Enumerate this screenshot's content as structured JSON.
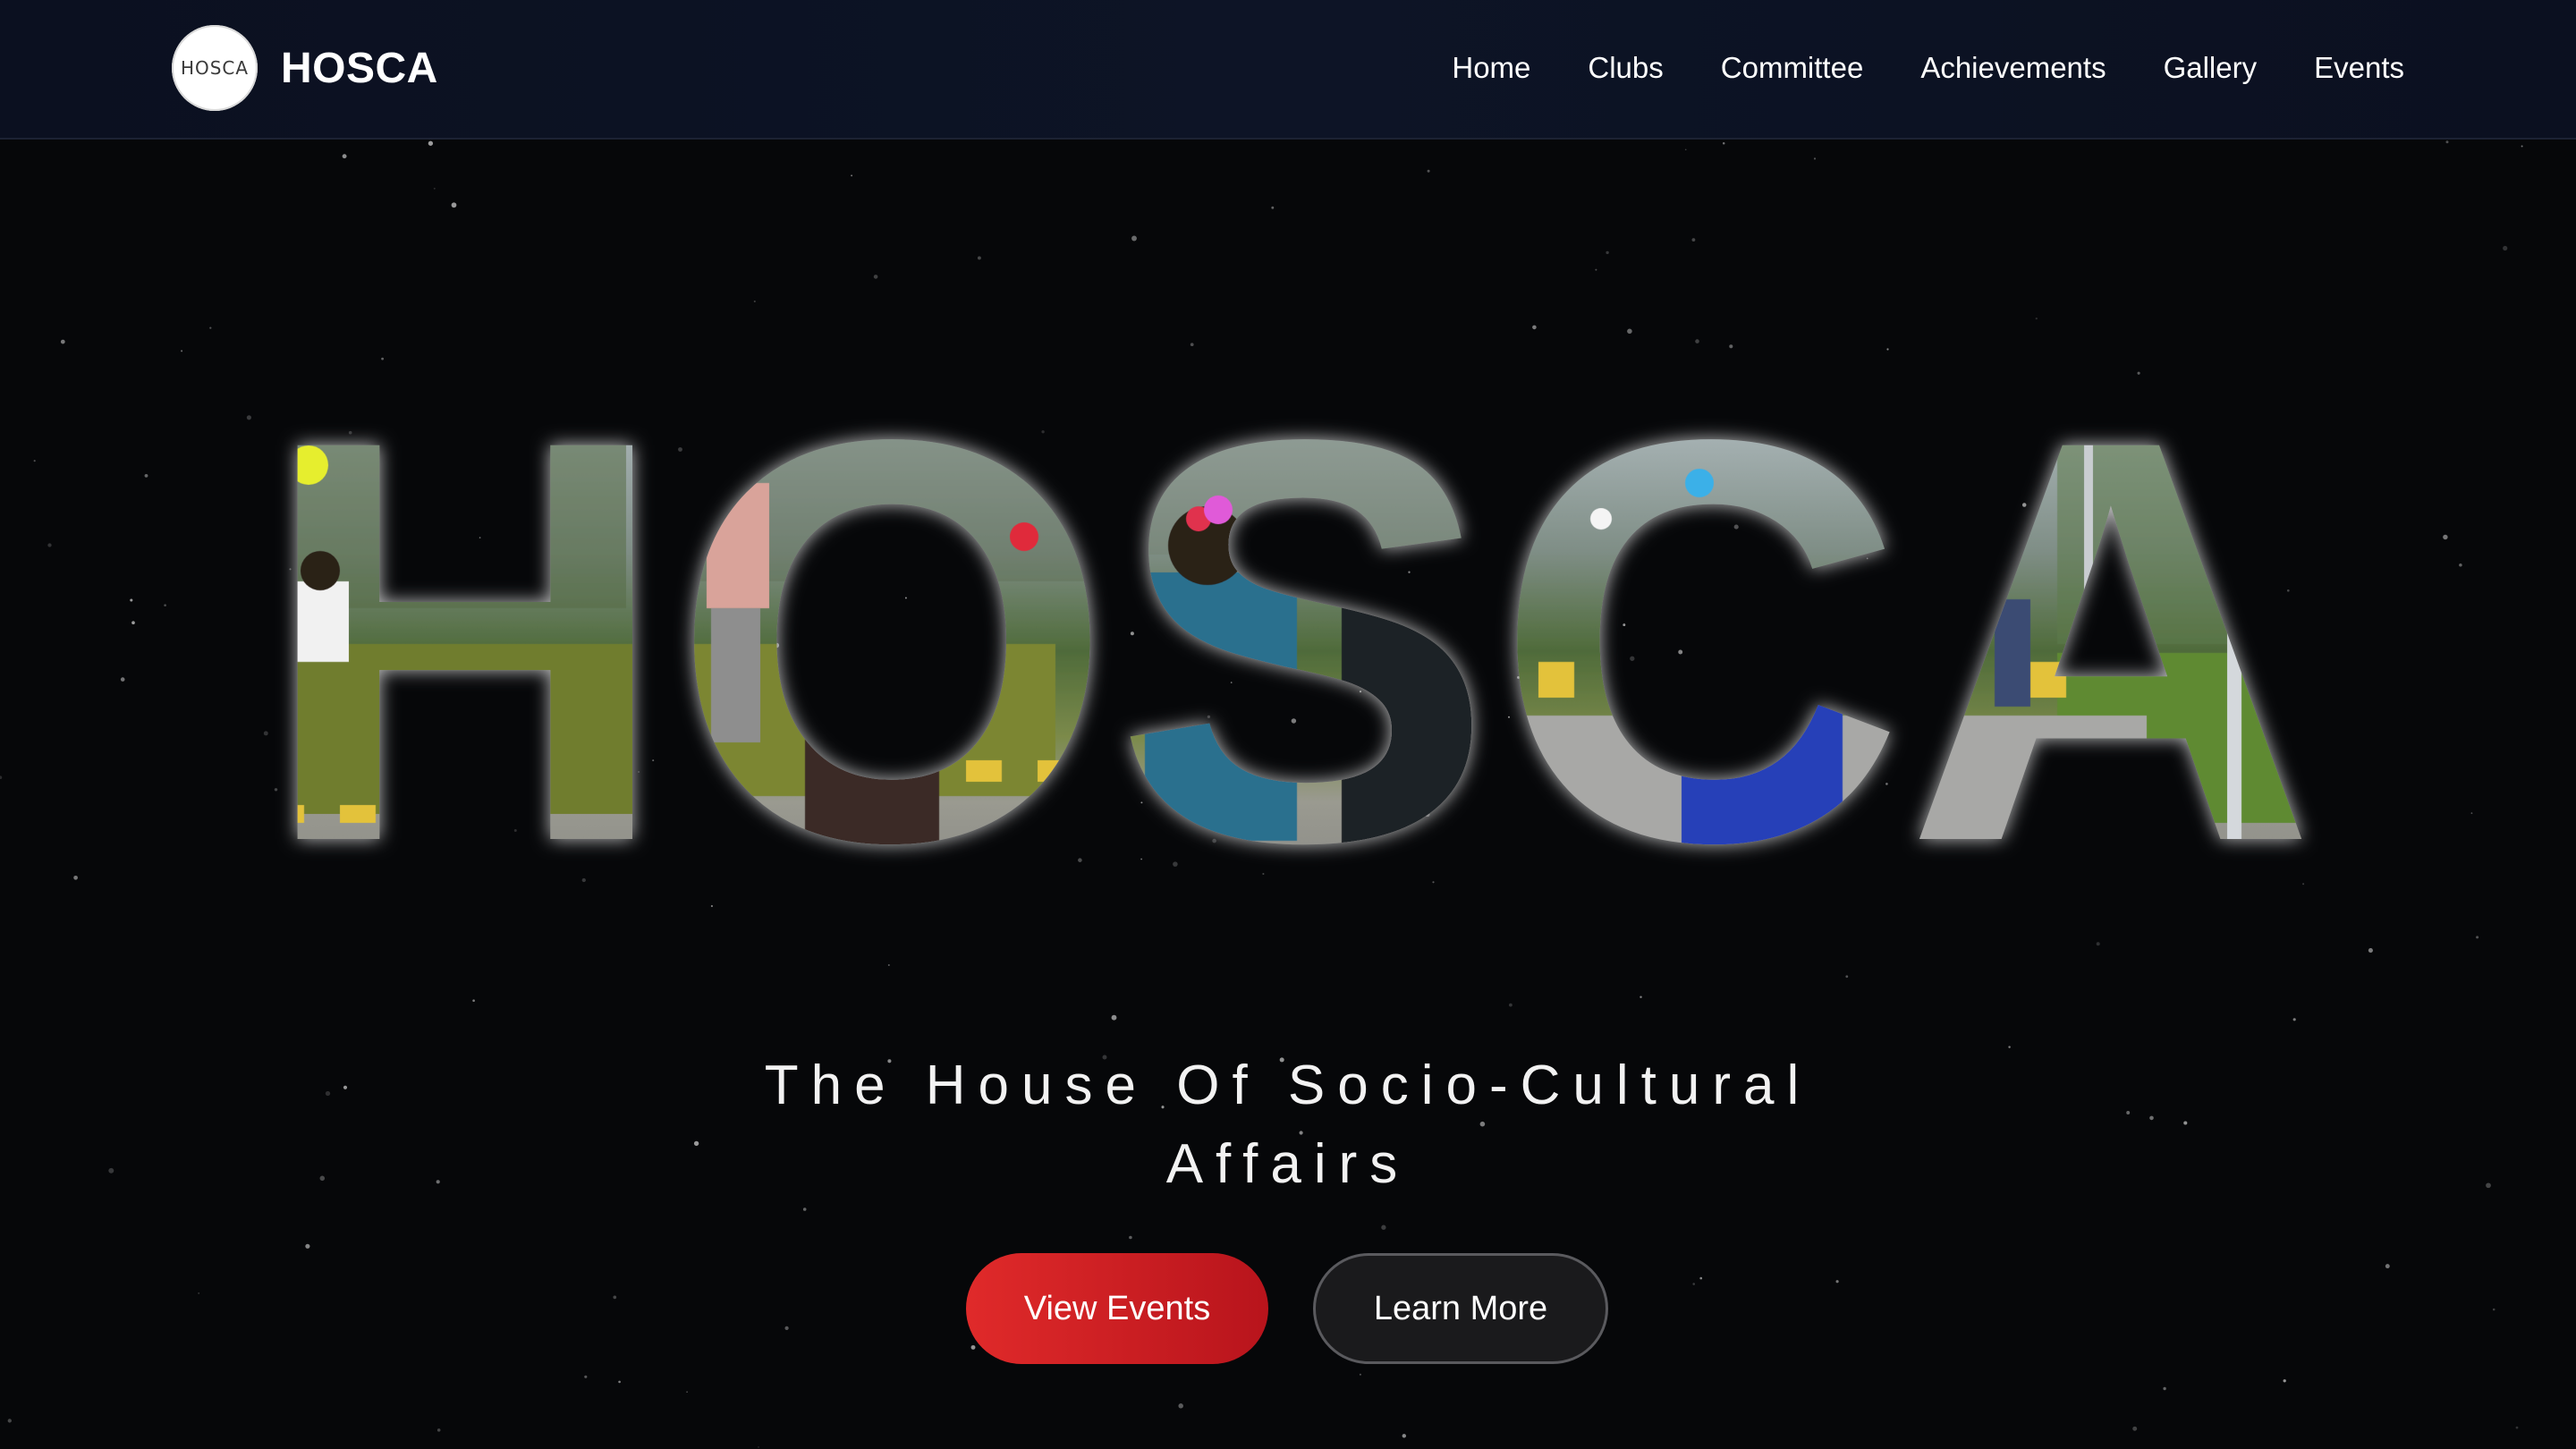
{
  "brand": {
    "logo_text": "HOSCA",
    "name": "HOSCA"
  },
  "nav": {
    "items": [
      {
        "label": "Home"
      },
      {
        "label": "Clubs"
      },
      {
        "label": "Committee"
      },
      {
        "label": "Achievements"
      },
      {
        "label": "Gallery"
      },
      {
        "label": "Events"
      }
    ]
  },
  "hero": {
    "word": "HOSCA",
    "tagline_line1": "The House Of Socio-Cultural",
    "tagline_line2": "Affairs"
  },
  "buttons": {
    "primary": "View Events",
    "secondary": "Learn More"
  },
  "colors": {
    "background": "#060709",
    "navbar": "#0b1020",
    "primary": "#d42224",
    "secondary_bg": "#1a1a1c",
    "text": "#ffffff"
  }
}
